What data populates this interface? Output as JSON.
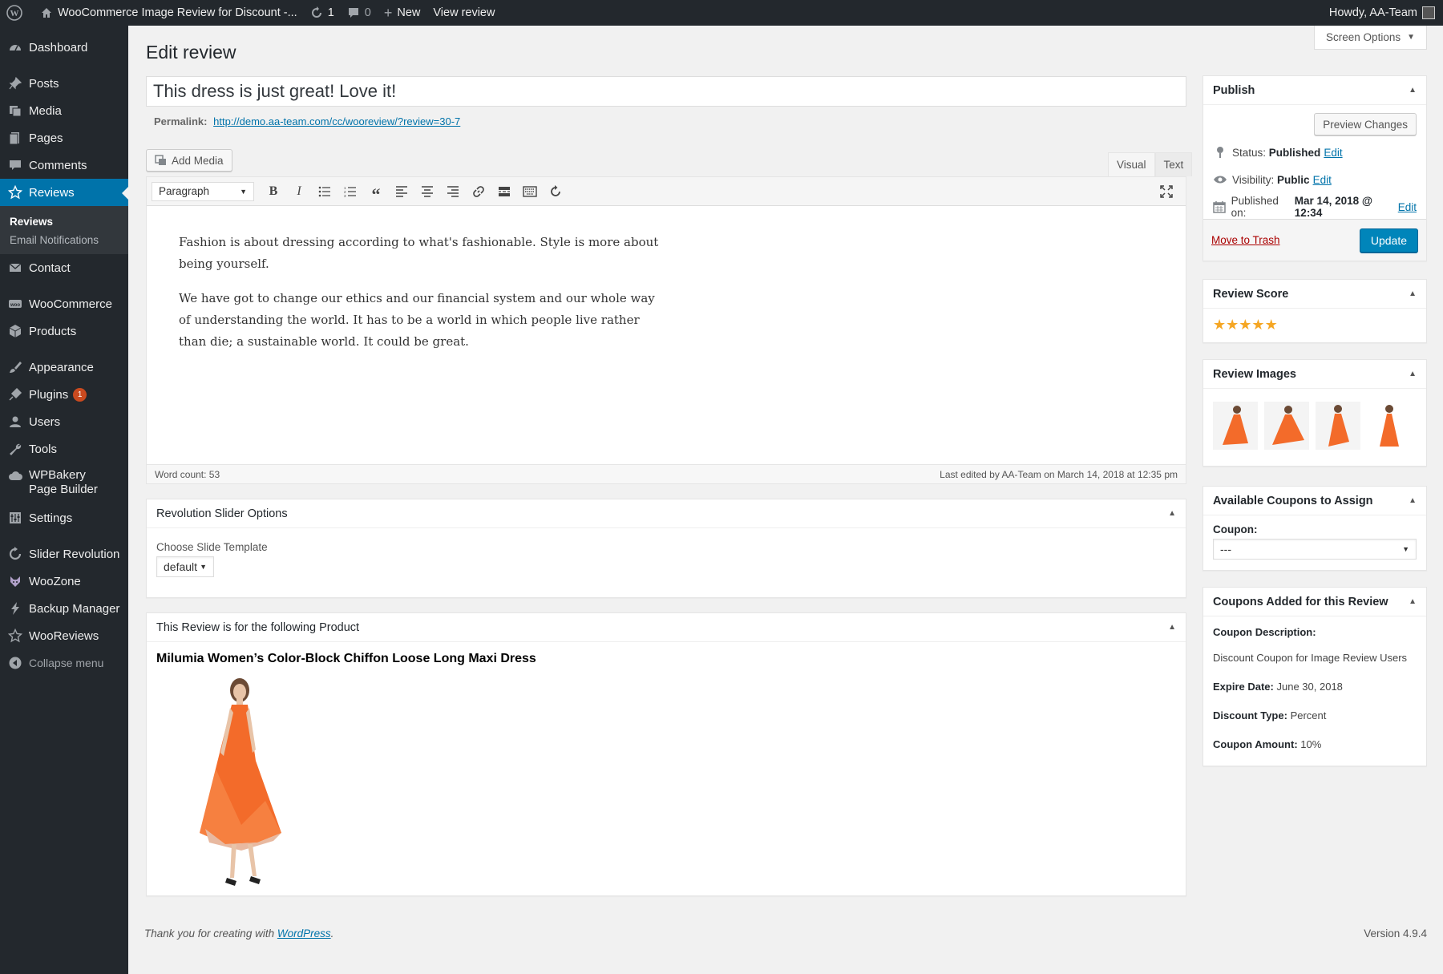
{
  "admin_bar": {
    "site_title": "WooCommerce Image Review for Discount -...",
    "updates_count": "1",
    "comments_count": "0",
    "new_label": "New",
    "view_label": "View review",
    "howdy": "Howdy, AA-Team"
  },
  "sidebar": {
    "items": [
      {
        "label": "Dashboard",
        "icon": "dashboard-icon"
      },
      {
        "label": "Posts",
        "icon": "pin-icon"
      },
      {
        "label": "Media",
        "icon": "media-icon"
      },
      {
        "label": "Pages",
        "icon": "page-icon"
      },
      {
        "label": "Comments",
        "icon": "comment-icon"
      },
      {
        "label": "Reviews",
        "icon": "star-icon"
      },
      {
        "label": "Contact",
        "icon": "mail-icon"
      },
      {
        "label": "WooCommerce",
        "icon": "woo-icon"
      },
      {
        "label": "Products",
        "icon": "box-icon"
      },
      {
        "label": "Appearance",
        "icon": "brush-icon"
      },
      {
        "label": "Plugins",
        "icon": "plugin-icon",
        "badge": "1"
      },
      {
        "label": "Users",
        "icon": "user-icon"
      },
      {
        "label": "Tools",
        "icon": "wrench-icon"
      },
      {
        "label": "WPBakery Page Builder",
        "icon": "cloud-icon"
      },
      {
        "label": "Settings",
        "icon": "settings-icon"
      },
      {
        "label": "Slider Revolution",
        "icon": "refresh-icon"
      },
      {
        "label": "WooZone",
        "icon": "fox-icon"
      },
      {
        "label": "Backup Manager",
        "icon": "bolt-icon"
      },
      {
        "label": "WooReviews",
        "icon": "star-icon"
      },
      {
        "label": "Collapse menu",
        "icon": "collapse-icon"
      }
    ],
    "submenu": [
      "Reviews",
      "Email Notifications"
    ]
  },
  "screen_options": "Screen Options",
  "page_title": "Edit review",
  "post_title": "This dress is just great! Love it!",
  "permalink": {
    "label": "Permalink:",
    "url": "http://demo.aa-team.com/cc/wooreview/?review=30-7"
  },
  "editor": {
    "add_media": "Add Media",
    "tab_visual": "Visual",
    "tab_text": "Text",
    "format": "Paragraph",
    "paragraphs": [
      "Fashion is about dressing according to what's fashionable. Style is more about being yourself.",
      "We have got to change our ethics and our financial system and our whole way of understanding the world. It has to be a world in which people live rather than die; a sustainable world. It could be great."
    ],
    "word_count": "Word count: 53",
    "last_edited": "Last edited by AA-Team on March 14, 2018 at 12:35 pm"
  },
  "revolution": {
    "title": "Revolution Slider Options",
    "label": "Choose Slide Template",
    "value": "default"
  },
  "product_box": {
    "title": "This Review is for the following Product",
    "product_name": "Milumia Women’s Color-Block Chiffon Loose Long Maxi Dress"
  },
  "publish": {
    "title": "Publish",
    "preview": "Preview Changes",
    "status_label": "Status:",
    "status_value": "Published",
    "visibility_label": "Visibility:",
    "visibility_value": "Public",
    "published_label": "Published on:",
    "published_value": "Mar 14, 2018 @ 12:34",
    "edit": "Edit",
    "trash": "Move to Trash",
    "update": "Update"
  },
  "review_score": {
    "title": "Review Score",
    "stars": 5
  },
  "review_images": {
    "title": "Review Images",
    "count": 4
  },
  "coupons_assign": {
    "title": "Available Coupons to Assign",
    "label": "Coupon:",
    "value": "---"
  },
  "coupons_added": {
    "title": "Coupons Added for this Review",
    "desc_label": "Coupon Description:",
    "desc_value": "Discount Coupon for Image Review Users",
    "expire_label": "Expire Date:",
    "expire_value": "June 30, 2018",
    "type_label": "Discount Type:",
    "type_value": "Percent",
    "amount_label": "Coupon Amount:",
    "amount_value": "10%"
  },
  "footer": {
    "thanks": "Thank you for creating with",
    "wp": "WordPress",
    "version": "Version 4.9.4"
  },
  "colors": {
    "accent": "#0073aa",
    "sidebar": "#23282d",
    "star": "#f5a623",
    "dress": "#f36b2a"
  }
}
